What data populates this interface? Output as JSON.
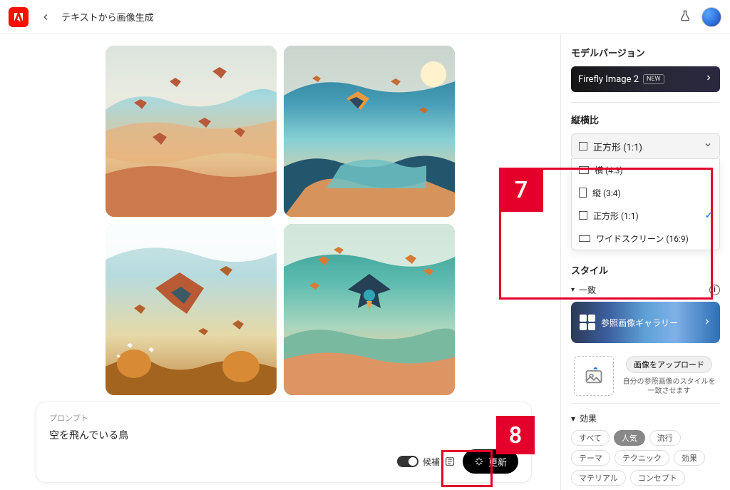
{
  "header": {
    "title": "テキストから画像生成"
  },
  "prompt": {
    "label": "プロンプト",
    "text": "空を飛んでいる鳥",
    "candidate_label": "候補",
    "update_label": "更新"
  },
  "sidebar": {
    "model_section_title": "モデルバージョン",
    "model_name": "Firefly Image 2",
    "model_badge": "NEW",
    "aspect_section_title": "縦横比",
    "aspect_selected": "正方形 (1:1)",
    "aspect_options": [
      {
        "label": "横 (4:3)",
        "ratio_class": "r43",
        "selected": false
      },
      {
        "label": "縦 (3:4)",
        "ratio_class": "r34",
        "selected": false
      },
      {
        "label": "正方形 (1:1)",
        "ratio_class": "r11",
        "selected": true
      },
      {
        "label": "ワイドスクリーン (16:9)",
        "ratio_class": "r169",
        "selected": false
      }
    ],
    "style_section_title": "スタイル",
    "match_label": "一致",
    "gallery_label": "参照画像ギャラリー",
    "upload_button": "画像をアップロード",
    "upload_desc": "自分の参照画像のスタイルを一致させます",
    "effects_label": "効果",
    "effect_chips": [
      "すべて",
      "人気",
      "流行",
      "テーマ",
      "テクニック",
      "効果",
      "マテリアル",
      "コンセプト"
    ],
    "effect_active_index": 1
  },
  "callouts": {
    "seven": "7",
    "eight": "8"
  }
}
